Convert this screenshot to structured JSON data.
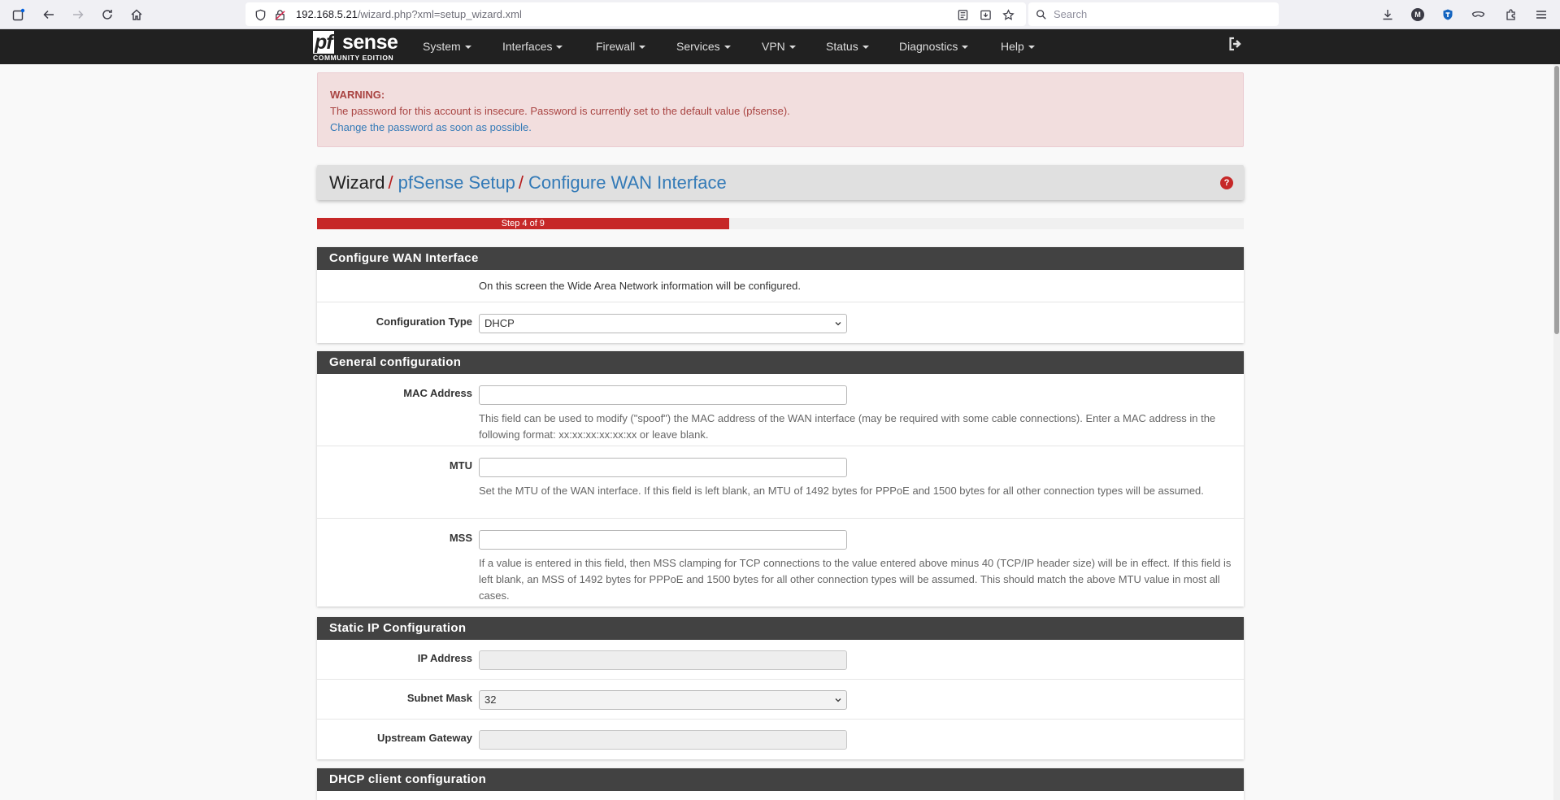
{
  "browser": {
    "url_host": "192.168.5.21",
    "url_path": "/wizard.php?xml=setup_wizard.xml",
    "search_placeholder": "Search",
    "account_initial": "M"
  },
  "nav": {
    "logo_pf": "pf",
    "logo_sense": "sense",
    "logo_sub": "COMMUNITY EDITION",
    "items": [
      "System",
      "Interfaces",
      "Firewall",
      "Services",
      "VPN",
      "Status",
      "Diagnostics",
      "Help"
    ]
  },
  "alert": {
    "title": "WARNING:",
    "message": "The password for this account is insecure. Password is currently set to the default value (pfsense).",
    "link": "Change the password as soon as possible."
  },
  "breadcrumb": {
    "root": "Wizard",
    "level1": "pfSense Setup",
    "level2": "Configure WAN Interface",
    "help": "?"
  },
  "progress": {
    "label": "Step 4 of 9",
    "step": 4,
    "total": 9
  },
  "wan_panel": {
    "heading": "Configure WAN Interface",
    "description": "On this screen the Wide Area Network information will be configured.",
    "config_type_label": "Configuration Type",
    "config_type_value": "DHCP"
  },
  "general_panel": {
    "heading": "General configuration",
    "mac_label": "MAC Address",
    "mac_value": "",
    "mac_help": "This field can be used to modify (\"spoof\") the MAC address of the WAN interface (may be required with some cable connections). Enter a MAC address in the following format: xx:xx:xx:xx:xx:xx or leave blank.",
    "mtu_label": "MTU",
    "mtu_value": "",
    "mtu_help": "Set the MTU of the WAN interface. If this field is left blank, an MTU of 1492 bytes for PPPoE and 1500 bytes for all other connection types will be assumed.",
    "mss_label": "MSS",
    "mss_value": "",
    "mss_help": "If a value is entered in this field, then MSS clamping for TCP connections to the value entered above minus 40 (TCP/IP header size) will be in effect. If this field is left blank, an MSS of 1492 bytes for PPPoE and 1500 bytes for all other connection types will be assumed. This should match the above MTU value in most all cases."
  },
  "static_panel": {
    "heading": "Static IP Configuration",
    "ip_label": "IP Address",
    "ip_value": "",
    "mask_label": "Subnet Mask",
    "mask_value": "32",
    "gateway_label": "Upstream Gateway",
    "gateway_value": ""
  },
  "dhcp_panel": {
    "heading": "DHCP client configuration"
  },
  "colors": {
    "navbar": "#212121",
    "accent_red": "#c62828",
    "link_blue": "#337ab7",
    "panel_heading": "#424242",
    "alert_bg": "#f2dede"
  }
}
